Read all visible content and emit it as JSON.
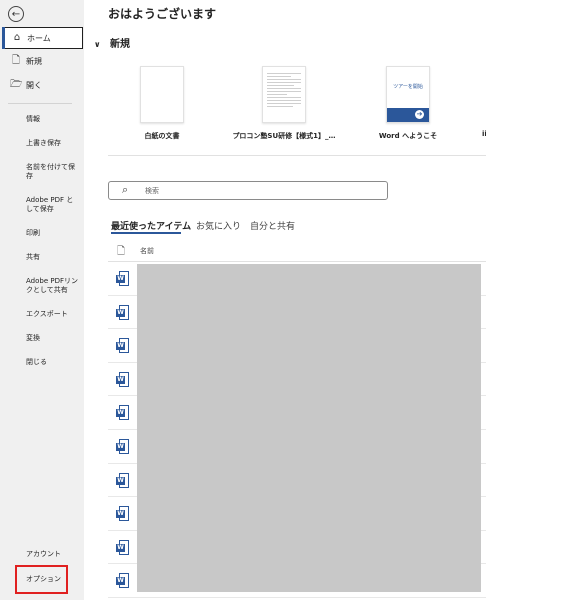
{
  "sidebar": {
    "back": "←",
    "nav": [
      {
        "label": "ホーム",
        "icon": "⌂"
      },
      {
        "label": "新規",
        "icon": "🗋"
      },
      {
        "label": "開く",
        "icon": "🗁"
      }
    ],
    "items": [
      "情報",
      "上書き保存",
      "名前を付けて保存",
      "Adobe PDF として保存",
      "印刷",
      "共有",
      "Adobe PDFリンクとして共有",
      "エクスポート",
      "変換",
      "閉じる"
    ],
    "bottom": [
      "アカウント",
      "オプション"
    ]
  },
  "main": {
    "greeting": "おはようございます",
    "new_section": {
      "title": "新規",
      "chevron": "∨"
    },
    "templates": [
      {
        "label": "白紙の文書"
      },
      {
        "label": "プロコン塾SU研修【様式1】_…"
      },
      {
        "label": "Word へようこそ",
        "thumb_text": "ツアーを開始"
      }
    ],
    "cut_label": "ii",
    "search": {
      "placeholder": "検索",
      "icon": "⌕"
    },
    "tabs": [
      "最近使ったアイテム",
      "お気に入り",
      "自分と共有"
    ],
    "list_header": {
      "name": "名前",
      "icon": "🗋"
    },
    "file_icon_letter": "W",
    "file_rows": 10
  },
  "colors": {
    "accent": "#2b579a",
    "highlight_box": "#e02020",
    "sidebar_bg": "#f0f0f0",
    "redaction": "#c8c8c8"
  }
}
